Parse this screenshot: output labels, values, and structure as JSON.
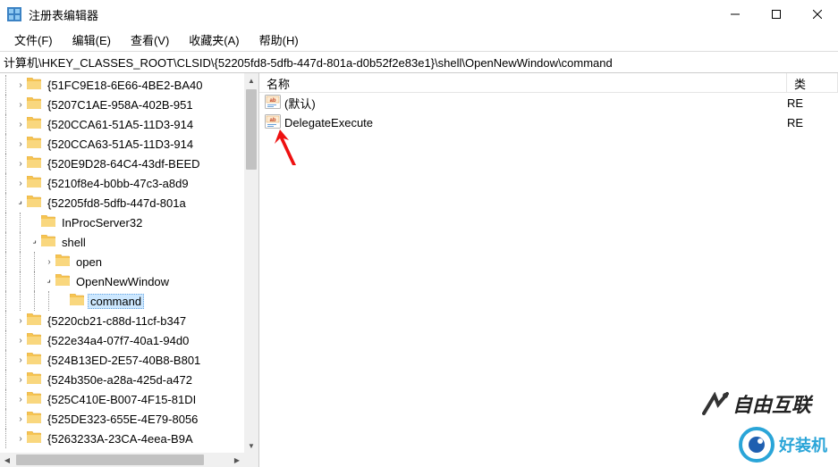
{
  "window": {
    "title": "注册表编辑器"
  },
  "menu": {
    "file": "文件(F)",
    "edit": "编辑(E)",
    "view": "查看(V)",
    "favorites": "收藏夹(A)",
    "help": "帮助(H)"
  },
  "address": {
    "path": "计算机\\HKEY_CLASSES_ROOT\\CLSID\\{52205fd8-5dfb-447d-801a-d0b52f2e83e1}\\shell\\OpenNewWindow\\command"
  },
  "tree": {
    "items": [
      {
        "label": "{51FC9E18-6E66-4BE2-BA40",
        "indent": 1,
        "expander": "closed",
        "selected": false
      },
      {
        "label": "{5207C1AE-958A-402B-951",
        "indent": 1,
        "expander": "closed",
        "selected": false
      },
      {
        "label": "{520CCA61-51A5-11D3-914",
        "indent": 1,
        "expander": "closed",
        "selected": false
      },
      {
        "label": "{520CCA63-51A5-11D3-914",
        "indent": 1,
        "expander": "closed",
        "selected": false
      },
      {
        "label": "{520E9D28-64C4-43df-BEED",
        "indent": 1,
        "expander": "closed",
        "selected": false
      },
      {
        "label": "{5210f8e4-b0bb-47c3-a8d9",
        "indent": 1,
        "expander": "closed",
        "selected": false
      },
      {
        "label": "{52205fd8-5dfb-447d-801a",
        "indent": 1,
        "expander": "open",
        "selected": false
      },
      {
        "label": "InProcServer32",
        "indent": 2,
        "expander": "none",
        "selected": false
      },
      {
        "label": "shell",
        "indent": 2,
        "expander": "open",
        "selected": false
      },
      {
        "label": "open",
        "indent": 3,
        "expander": "closed",
        "selected": false
      },
      {
        "label": "OpenNewWindow",
        "indent": 3,
        "expander": "open",
        "selected": false
      },
      {
        "label": "command",
        "indent": 4,
        "expander": "none",
        "selected": true
      },
      {
        "label": "{5220cb21-c88d-11cf-b347",
        "indent": 1,
        "expander": "closed",
        "selected": false
      },
      {
        "label": "{522e34a4-07f7-40a1-94d0",
        "indent": 1,
        "expander": "closed",
        "selected": false
      },
      {
        "label": "{524B13ED-2E57-40B8-B801",
        "indent": 1,
        "expander": "closed",
        "selected": false
      },
      {
        "label": "{524b350e-a28a-425d-a472",
        "indent": 1,
        "expander": "closed",
        "selected": false
      },
      {
        "label": "{525C410E-B007-4F15-81DI",
        "indent": 1,
        "expander": "closed",
        "selected": false
      },
      {
        "label": "{525DE323-655E-4E79-8056",
        "indent": 1,
        "expander": "closed",
        "selected": false
      },
      {
        "label": "{5263233A-23CA-4eea-B9A",
        "indent": 1,
        "expander": "closed",
        "selected": false
      }
    ]
  },
  "list": {
    "header_name": "名称",
    "header_type": "类",
    "rows": [
      {
        "name": "(默认)",
        "type": "RE"
      },
      {
        "name": "DelegateExecute",
        "type": "RE"
      }
    ]
  },
  "watermark": {
    "wm1": "自由互联",
    "wm2": "好装机"
  }
}
